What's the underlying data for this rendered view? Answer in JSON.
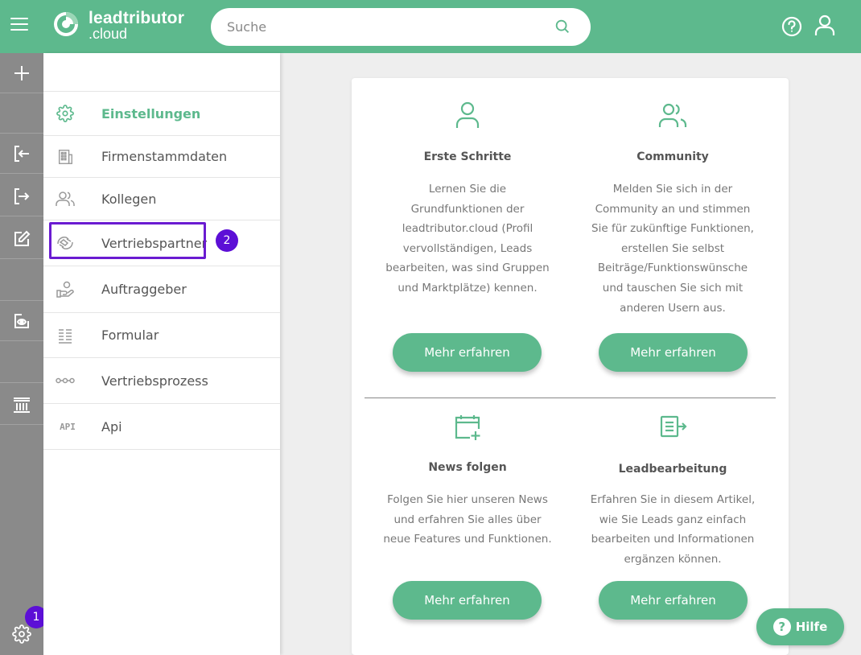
{
  "header": {
    "brand_line1": "leadtributor",
    "brand_line2": ".cloud",
    "search_placeholder": "Suche"
  },
  "rail": {
    "icons": [
      "plus-icon",
      "sign-in-icon",
      "sign-out-icon",
      "edit-icon",
      "eye-icon",
      "bank-icon",
      "gear-icon"
    ],
    "badge_settings": "1"
  },
  "menu": {
    "items": [
      {
        "label": "Einstellungen",
        "icon": "gear-icon",
        "active": true
      },
      {
        "label": "Firmenstammdaten",
        "icon": "building-icon"
      },
      {
        "label": "Kollegen",
        "icon": "users-icon"
      },
      {
        "label": "Vertriebspartner",
        "icon": "handshake-icon"
      },
      {
        "label": "Auftraggeber",
        "icon": "client-hand-icon"
      },
      {
        "label": "Formular",
        "icon": "form-icon"
      },
      {
        "label": "Vertriebsprozess",
        "icon": "process-icon"
      },
      {
        "label": "Api",
        "icon": "api-icon"
      }
    ],
    "api_icon_text": "API",
    "badge_partner": "2"
  },
  "tiles": [
    {
      "title": "Erste Schritte",
      "lines": [
        "Lernen Sie die",
        "Grundfunktionen der",
        "leadtributor.cloud (Profil",
        "vervollständigen, Leads",
        "bearbeiten, was sind Gruppen",
        "und Marktplätze) kennen."
      ],
      "button": "Mehr erfahren",
      "icon": "user-icon"
    },
    {
      "title": "Community",
      "lines": [
        "Melden Sie sich in der",
        "Community an und stimmen",
        "Sie für zukünftige Funktionen,",
        "erstellen Sie selbst",
        "Beiträge/Funktionswünsche",
        "und tauschen Sie sich mit",
        "anderen Usern aus."
      ],
      "button": "Mehr erfahren",
      "icon": "users-icon"
    },
    {
      "title": "News folgen",
      "lines": [
        "Folgen Sie hier unseren News",
        "und erfahren Sie alles über",
        "neue Features und Funktionen."
      ],
      "button": "Mehr erfahren",
      "icon": "calendar-add-icon"
    },
    {
      "title": "Leadbearbeitung",
      "lines": [
        "Erfahren Sie in diesem Artikel,",
        "wie Sie Leads ganz einfach",
        "bearbeiten und Informationen",
        "ergänzen können."
      ],
      "button": "Mehr erfahren",
      "icon": "document-export-icon"
    }
  ],
  "help_button": {
    "label": "Hilfe",
    "icon_text": "?"
  },
  "colors": {
    "accent": "#5db98d",
    "rail": "#8a8a8a",
    "badge": "#5c0fd6"
  }
}
